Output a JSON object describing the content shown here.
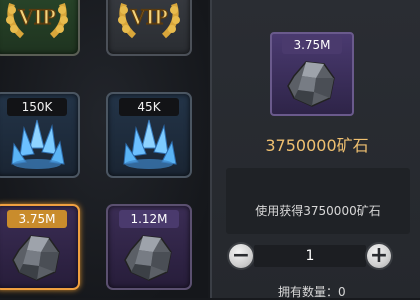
{
  "inventory": {
    "slots": [
      {
        "badge": "VIP",
        "kind": "vip-laurel"
      },
      {
        "badge": "VIP",
        "kind": "vip-laurel"
      },
      {
        "badge": "150K",
        "kind": "crystal"
      },
      {
        "badge": "45K",
        "kind": "crystal"
      },
      {
        "badge": "3.75M",
        "kind": "ore"
      },
      {
        "badge": "1.12M",
        "kind": "ore"
      }
    ]
  },
  "detail": {
    "badge": "3.75M",
    "title": "3750000矿石",
    "description": "使用获得3750000矿石",
    "quantity": "1",
    "minus_symbol": "−",
    "plus_symbol": "+",
    "owned_label": "拥有数量：",
    "owned_value": "0"
  },
  "colors": {
    "selected_border": "#f0a040",
    "title": "#f0c070",
    "gold_badge": "#c98c2c",
    "purple_badge": "#4a3a6d"
  }
}
